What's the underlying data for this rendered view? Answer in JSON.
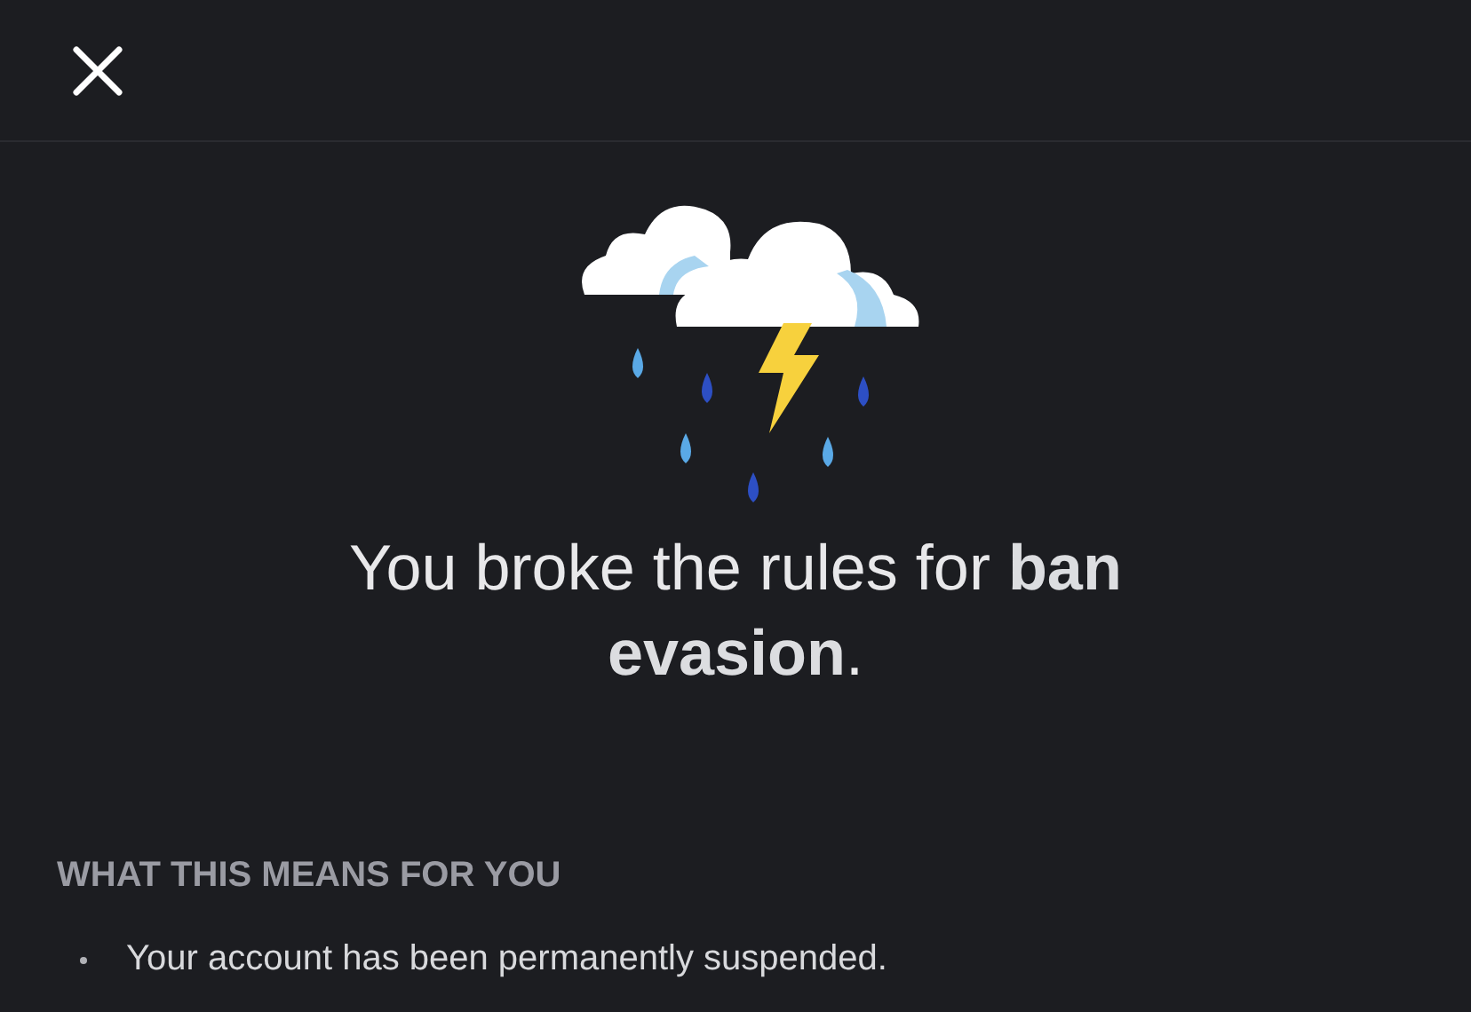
{
  "heading": "You broke the rules for **ban evasion**.",
  "section": {
    "title": "WHAT THIS MEANS FOR YOU",
    "bullets": [
      "Your account has been permanently suspended."
    ]
  }
}
